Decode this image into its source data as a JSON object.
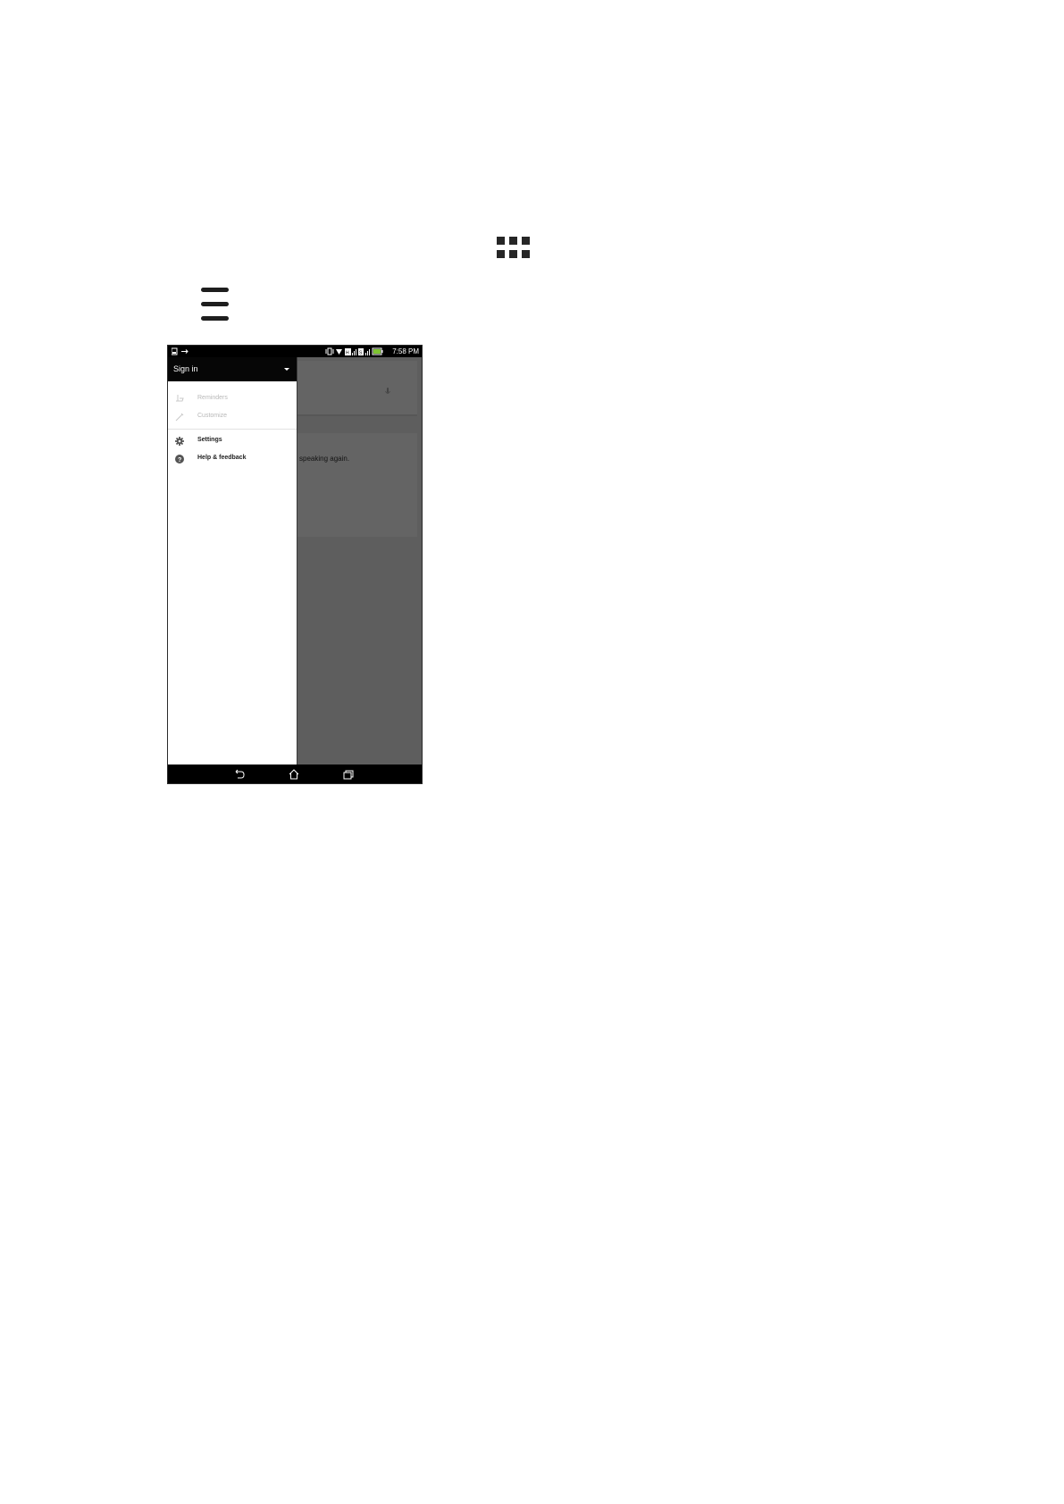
{
  "document": {
    "icons": [
      "apps-grid-icon",
      "hamburger-menu-icon"
    ]
  },
  "phone": {
    "status_bar": {
      "time": "7:58 PM",
      "icons": [
        "screenshot-icon",
        "usb-icon",
        "vibrate-icon",
        "wifi-icon",
        "sim-icon",
        "signal-icon",
        "battery-icon"
      ],
      "battery_color": "#7ec431"
    },
    "drawer": {
      "header": {
        "title": "Sign in",
        "icon": "dropdown-arrow-icon"
      },
      "items": [
        {
          "label": "Reminders",
          "icon": "reminder-icon",
          "enabled": false
        },
        {
          "label": "Customize",
          "icon": "customize-icon",
          "enabled": false
        },
        {
          "label": "Settings",
          "icon": "gear-icon",
          "enabled": true
        },
        {
          "label": "Help & feedback",
          "icon": "help-icon",
          "enabled": true
        }
      ]
    },
    "background": {
      "card_text": "speaking again."
    },
    "nav_bar": {
      "buttons": [
        "back-icon",
        "home-icon",
        "recent-apps-icon"
      ]
    }
  }
}
